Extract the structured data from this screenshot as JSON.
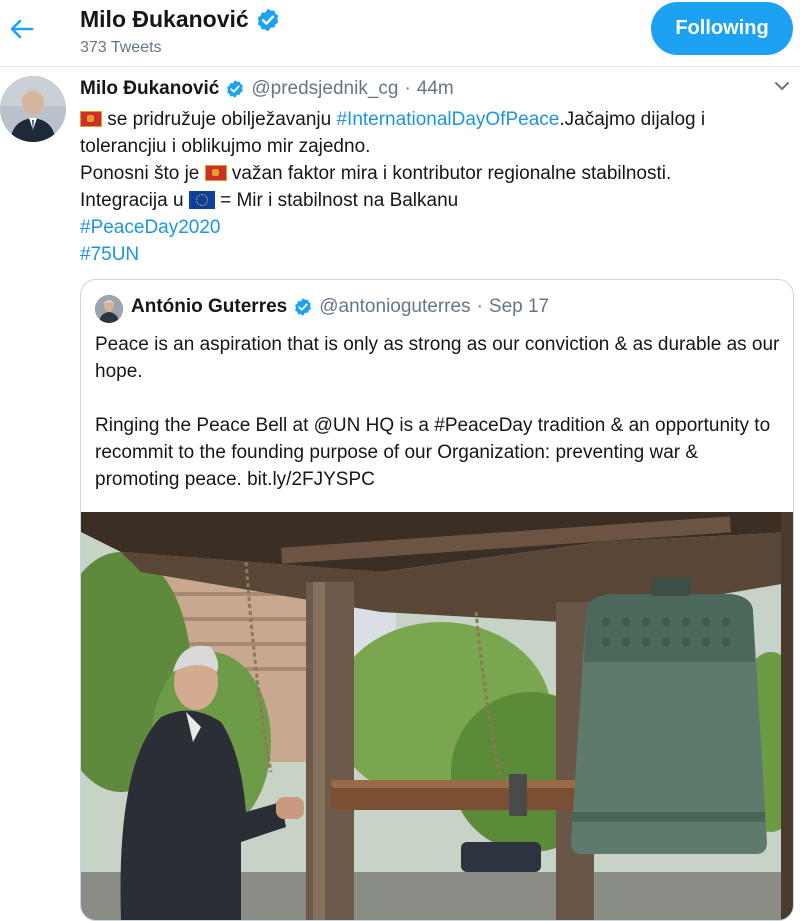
{
  "header": {
    "display_name": "Milo Đukanović",
    "tweet_count": "373 Tweets",
    "follow_label": "Following"
  },
  "tweet": {
    "display_name": "Milo Đukanović",
    "handle": "@predsjednik_cg",
    "separator": "·",
    "time": "44m",
    "line1_text": " se pridružuje obilježavanju ",
    "hashtag_peace": "#InternationalDayOfPeace",
    "line1_tail": ".Jačajmo dijalog i tolerancjiu i oblikujmo mir zajedno.",
    "line2_pre": "Ponosni što je ",
    "line2_post": " važan faktor mira i kontributor regionalne stabilnosti.",
    "line3_pre": "Integracija u ",
    "line3_post": " = Mir i stabilnost na Balkanu",
    "hashtag_2020": "#PeaceDay2020",
    "hashtag_75un": "#75UN"
  },
  "quote": {
    "display_name": "António Guterres",
    "handle": "@antonioguterres",
    "separator": "·",
    "date": "Sep 17",
    "para1": "Peace is an aspiration that is only as strong as our conviction & as durable as our hope.",
    "para2": "Ringing the Peace Bell at @UN HQ is a #PeaceDay tradition & an opportunity to recommit to the founding purpose of our Organization: preventing war & promoting peace. bit.ly/2FJYSPC"
  },
  "colors": {
    "accent": "#1da1f2",
    "hashtag": "#1b95e0",
    "secondary_text": "#657786",
    "border": "#ccd6dd"
  },
  "icons": {
    "back": "arrow-left-icon",
    "verified": "verified-badge-icon",
    "more": "chevron-down-icon",
    "flag_montenegro": "montenegro-flag-icon",
    "flag_eu": "eu-flag-icon"
  }
}
